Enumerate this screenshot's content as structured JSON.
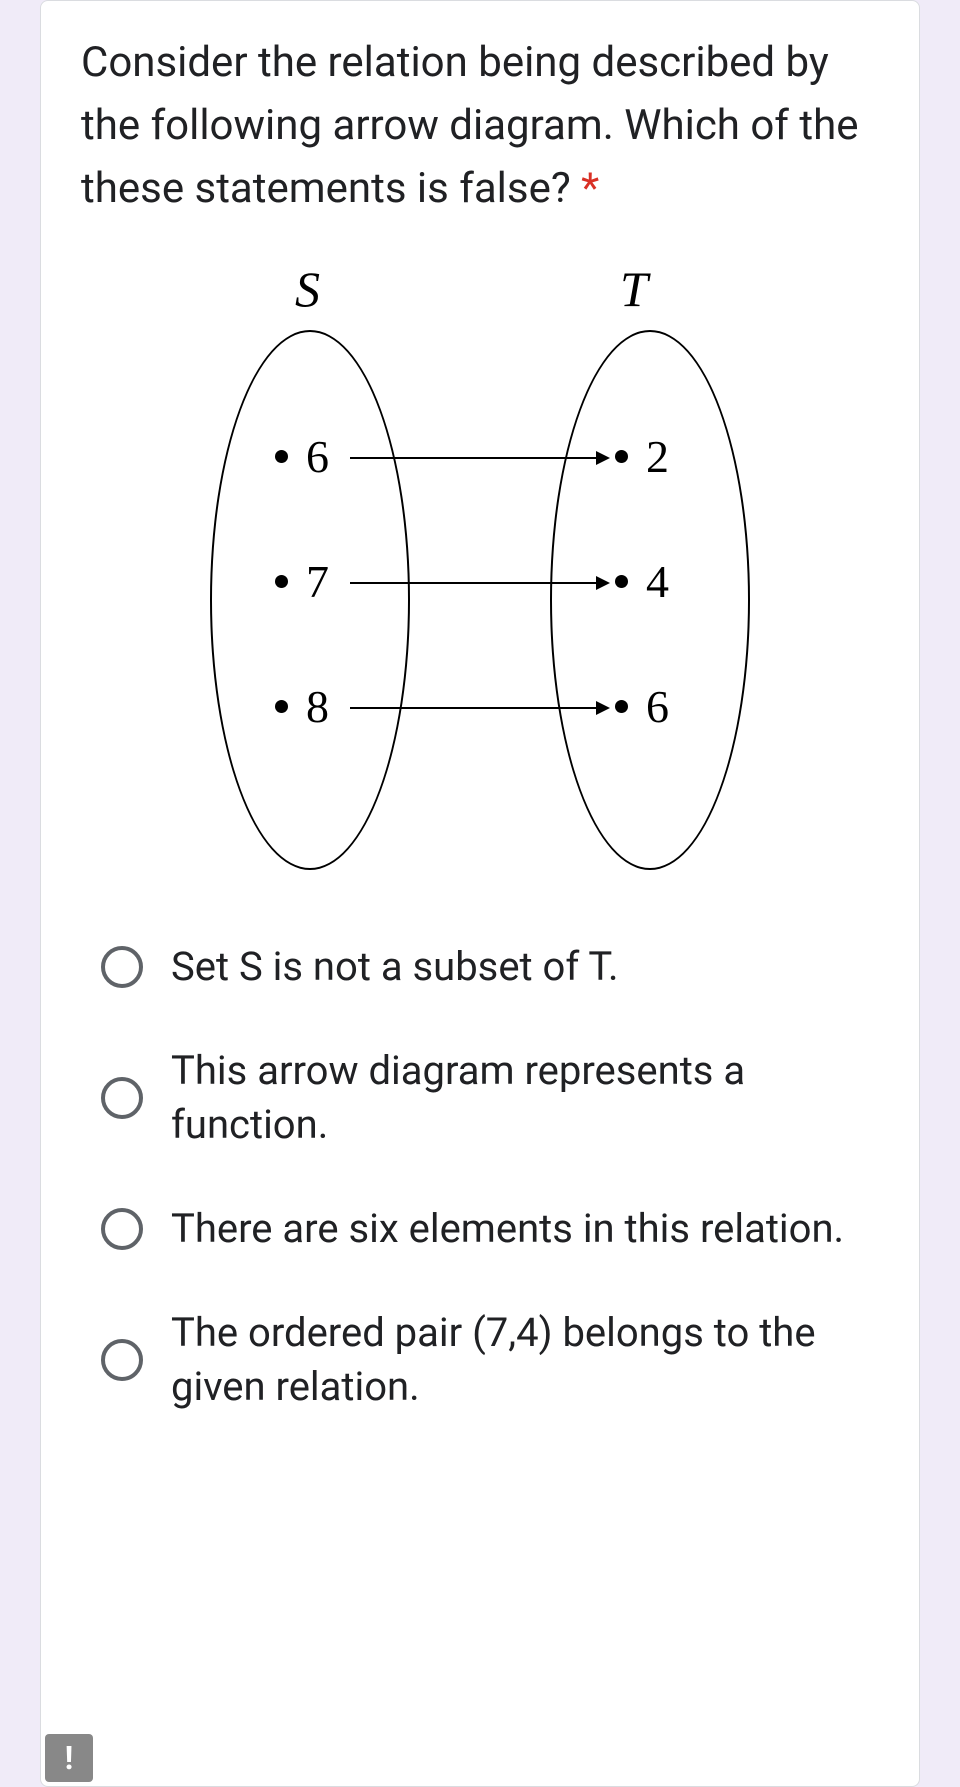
{
  "question": {
    "text": "Consider the relation being described by the following arrow diagram. Which of the these statements is false?",
    "required_marker": "*"
  },
  "diagram": {
    "set_s_label": "S",
    "set_t_label": "T",
    "s_elements": [
      "6",
      "7",
      "8"
    ],
    "t_elements": [
      "2",
      "4",
      "6"
    ]
  },
  "options": [
    "Set S is not a subset of T.",
    "This arrow diagram represents a function.",
    "There are six elements in this relation.",
    "The ordered pair (7,4) belongs to the given relation."
  ],
  "report_icon": "!"
}
